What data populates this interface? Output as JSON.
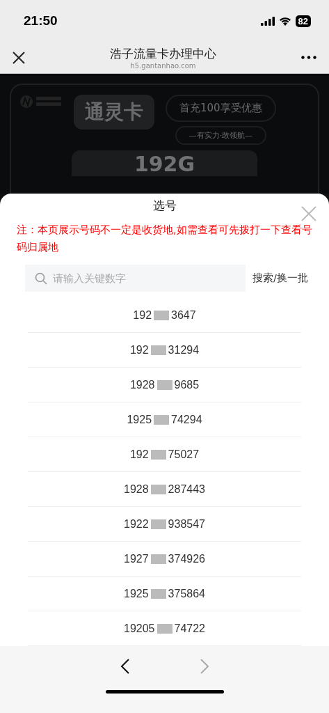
{
  "status_bar": {
    "time": "21:50",
    "battery": "82"
  },
  "nav": {
    "title": "浩子流量卡办理中心",
    "url": "h5.gantanhao.com"
  },
  "backdrop": {
    "card_name": "通灵卡",
    "promo": "首充100享受优惠",
    "slogan": "—有实力·敢领航—",
    "data_amount": "192G"
  },
  "sheet": {
    "title": "选号",
    "notice": "注：本页展示号码不一定是收货地,如需查看可先拨打一下查看号码归属地",
    "search": {
      "placeholder": "请输入关键数字"
    },
    "search_button": "搜索/换一批",
    "numbers": [
      {
        "head": "192",
        "tail": "3647"
      },
      {
        "head": "192",
        "tail": "31294"
      },
      {
        "head": "1928",
        "tail": "9685"
      },
      {
        "head": "1925",
        "tail": "74294"
      },
      {
        "head": "192",
        "tail": "75027"
      },
      {
        "head": "1928",
        "tail": "287443"
      },
      {
        "head": "1922",
        "tail": "938547"
      },
      {
        "head": "1927",
        "tail": "374926"
      },
      {
        "head": "1925",
        "tail": "375864"
      },
      {
        "head": "19205",
        "tail": "74722"
      }
    ]
  },
  "browser_bar": {
    "back_disabled": false,
    "forward_disabled": true
  }
}
